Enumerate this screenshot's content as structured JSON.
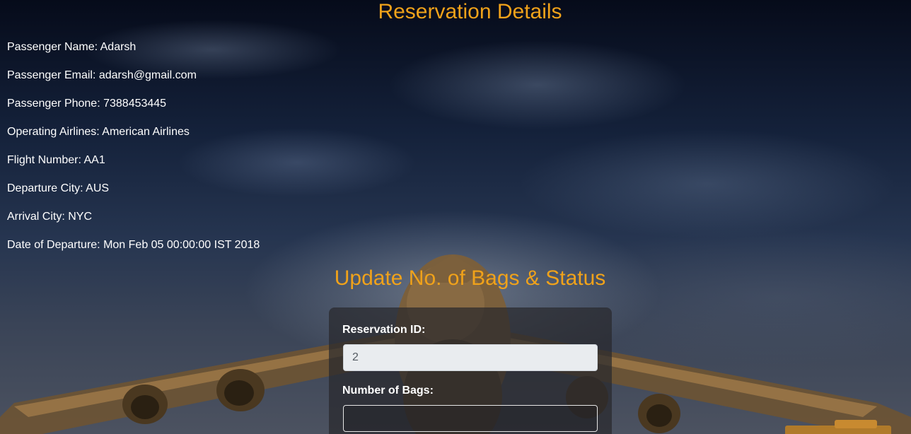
{
  "page": {
    "title": "Reservation Details",
    "update_title": "Update No. of Bags & Status"
  },
  "details": [
    {
      "label": "Passenger Name:",
      "value": "Adarsh",
      "text": "Passenger Name: Adarsh"
    },
    {
      "label": "Passenger Email:",
      "value": "adarsh@gmail.com",
      "text": "Passenger Email: adarsh@gmail.com"
    },
    {
      "label": "Passenger Phone:",
      "value": "7388453445",
      "text": "Passenger Phone: 7388453445"
    },
    {
      "label": "Operating Airlines:",
      "value": "American Airlines",
      "text": "Operating Airlines: American Airlines"
    },
    {
      "label": "Flight Number:",
      "value": "AA1",
      "text": "Flight Number: AA1"
    },
    {
      "label": "Departure City:",
      "value": "AUS",
      "text": "Departure City: AUS"
    },
    {
      "label": "Arrival City:",
      "value": "NYC",
      "text": "Arrival City: NYC"
    },
    {
      "label": "Date of Departure:",
      "value": "Mon Feb 05 00:00:00 IST 2018",
      "text": "Date of Departure: Mon Feb 05 00:00:00 IST 2018"
    }
  ],
  "form": {
    "reservation_id_label": "Reservation ID:",
    "reservation_id_value": "2",
    "bags_label": "Number of Bags:",
    "bags_value": ""
  },
  "colors": {
    "heading": "#f0a21a",
    "text": "#ffffff",
    "panel": "rgba(40,40,44,0.72)",
    "readonly_input": "#e9ecef"
  }
}
